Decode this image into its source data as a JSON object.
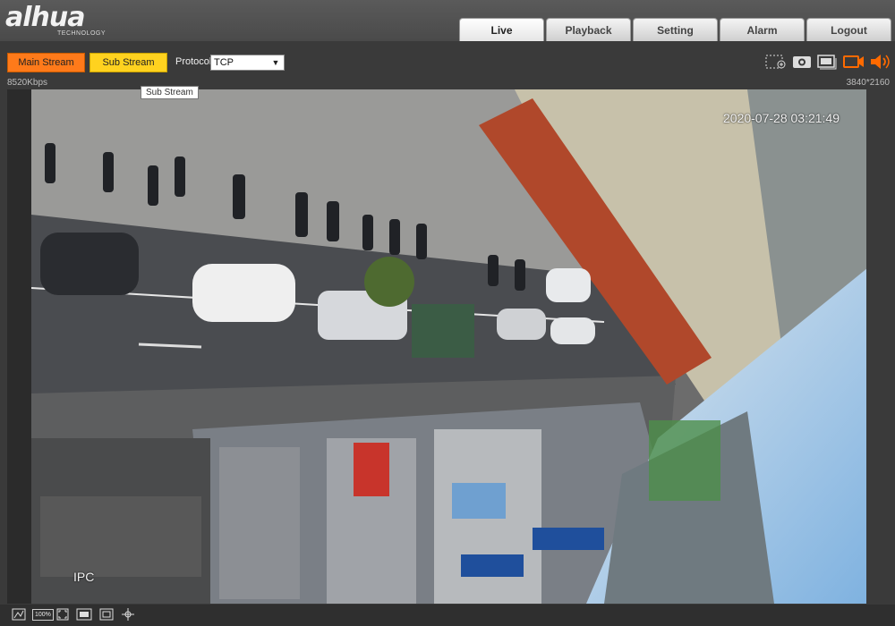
{
  "brand": {
    "logo_text": "alhua",
    "logo_sub": "TECHNOLOGY"
  },
  "tabs": [
    {
      "label": "Live",
      "active": true
    },
    {
      "label": "Playback"
    },
    {
      "label": "Setting"
    },
    {
      "label": "Alarm"
    },
    {
      "label": "Logout"
    }
  ],
  "toolbar": {
    "main_stream": "Main Stream",
    "sub_stream": "Sub Stream",
    "protocol_label": "Protocol",
    "protocol_value": "TCP",
    "icons": [
      "zoom-region-icon",
      "snapshot-icon",
      "triple-snapshot-icon",
      "record-icon",
      "audio-icon"
    ]
  },
  "status": {
    "bitrate": "8520Kbps",
    "resolution": "3840*2160"
  },
  "tooltip": "Sub Stream",
  "video": {
    "timestamp": "2020-07-28 03:21:49",
    "channel_name": "IPC"
  },
  "bottom": {
    "zoom_label": "100%",
    "icons": [
      "fisheye-icon",
      "zoom-100-icon",
      "fullscreen-icon",
      "ratio-icon",
      "smart-icon",
      "ptz-icon"
    ]
  },
  "colors": {
    "main_stream": "#ff7a1a",
    "sub_stream": "#ffd21f",
    "record": "#ff6a00"
  }
}
